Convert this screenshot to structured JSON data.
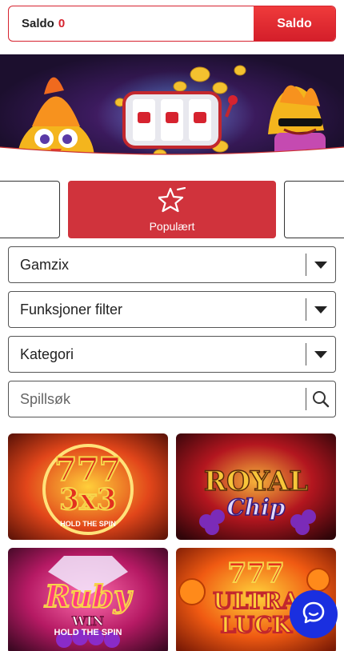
{
  "balance": {
    "label": "Saldo",
    "value": "0",
    "button_label": "Saldo"
  },
  "categories": {
    "active_label": "Populært"
  },
  "filters": {
    "provider": "Gamzix",
    "features": "Funksjoner filter",
    "category": "Kategori",
    "search_placeholder": "Spillsøk"
  },
  "games": [
    {
      "title_line1": "777",
      "title_line2": "3x3",
      "subtitle": "HOLD THE SPIN"
    },
    {
      "title_line1": "ROYAL",
      "title_line2": "Chip",
      "subtitle": ""
    },
    {
      "title_line1": "Ruby",
      "title_line2": "WIN",
      "subtitle": "HOLD THE SPIN"
    },
    {
      "title_line1": "777",
      "title_line2": "ULTRA LUCK",
      "subtitle": ""
    }
  ],
  "colors": {
    "brand_red": "#d6232f",
    "chat_blue": "#1a2fe0"
  }
}
